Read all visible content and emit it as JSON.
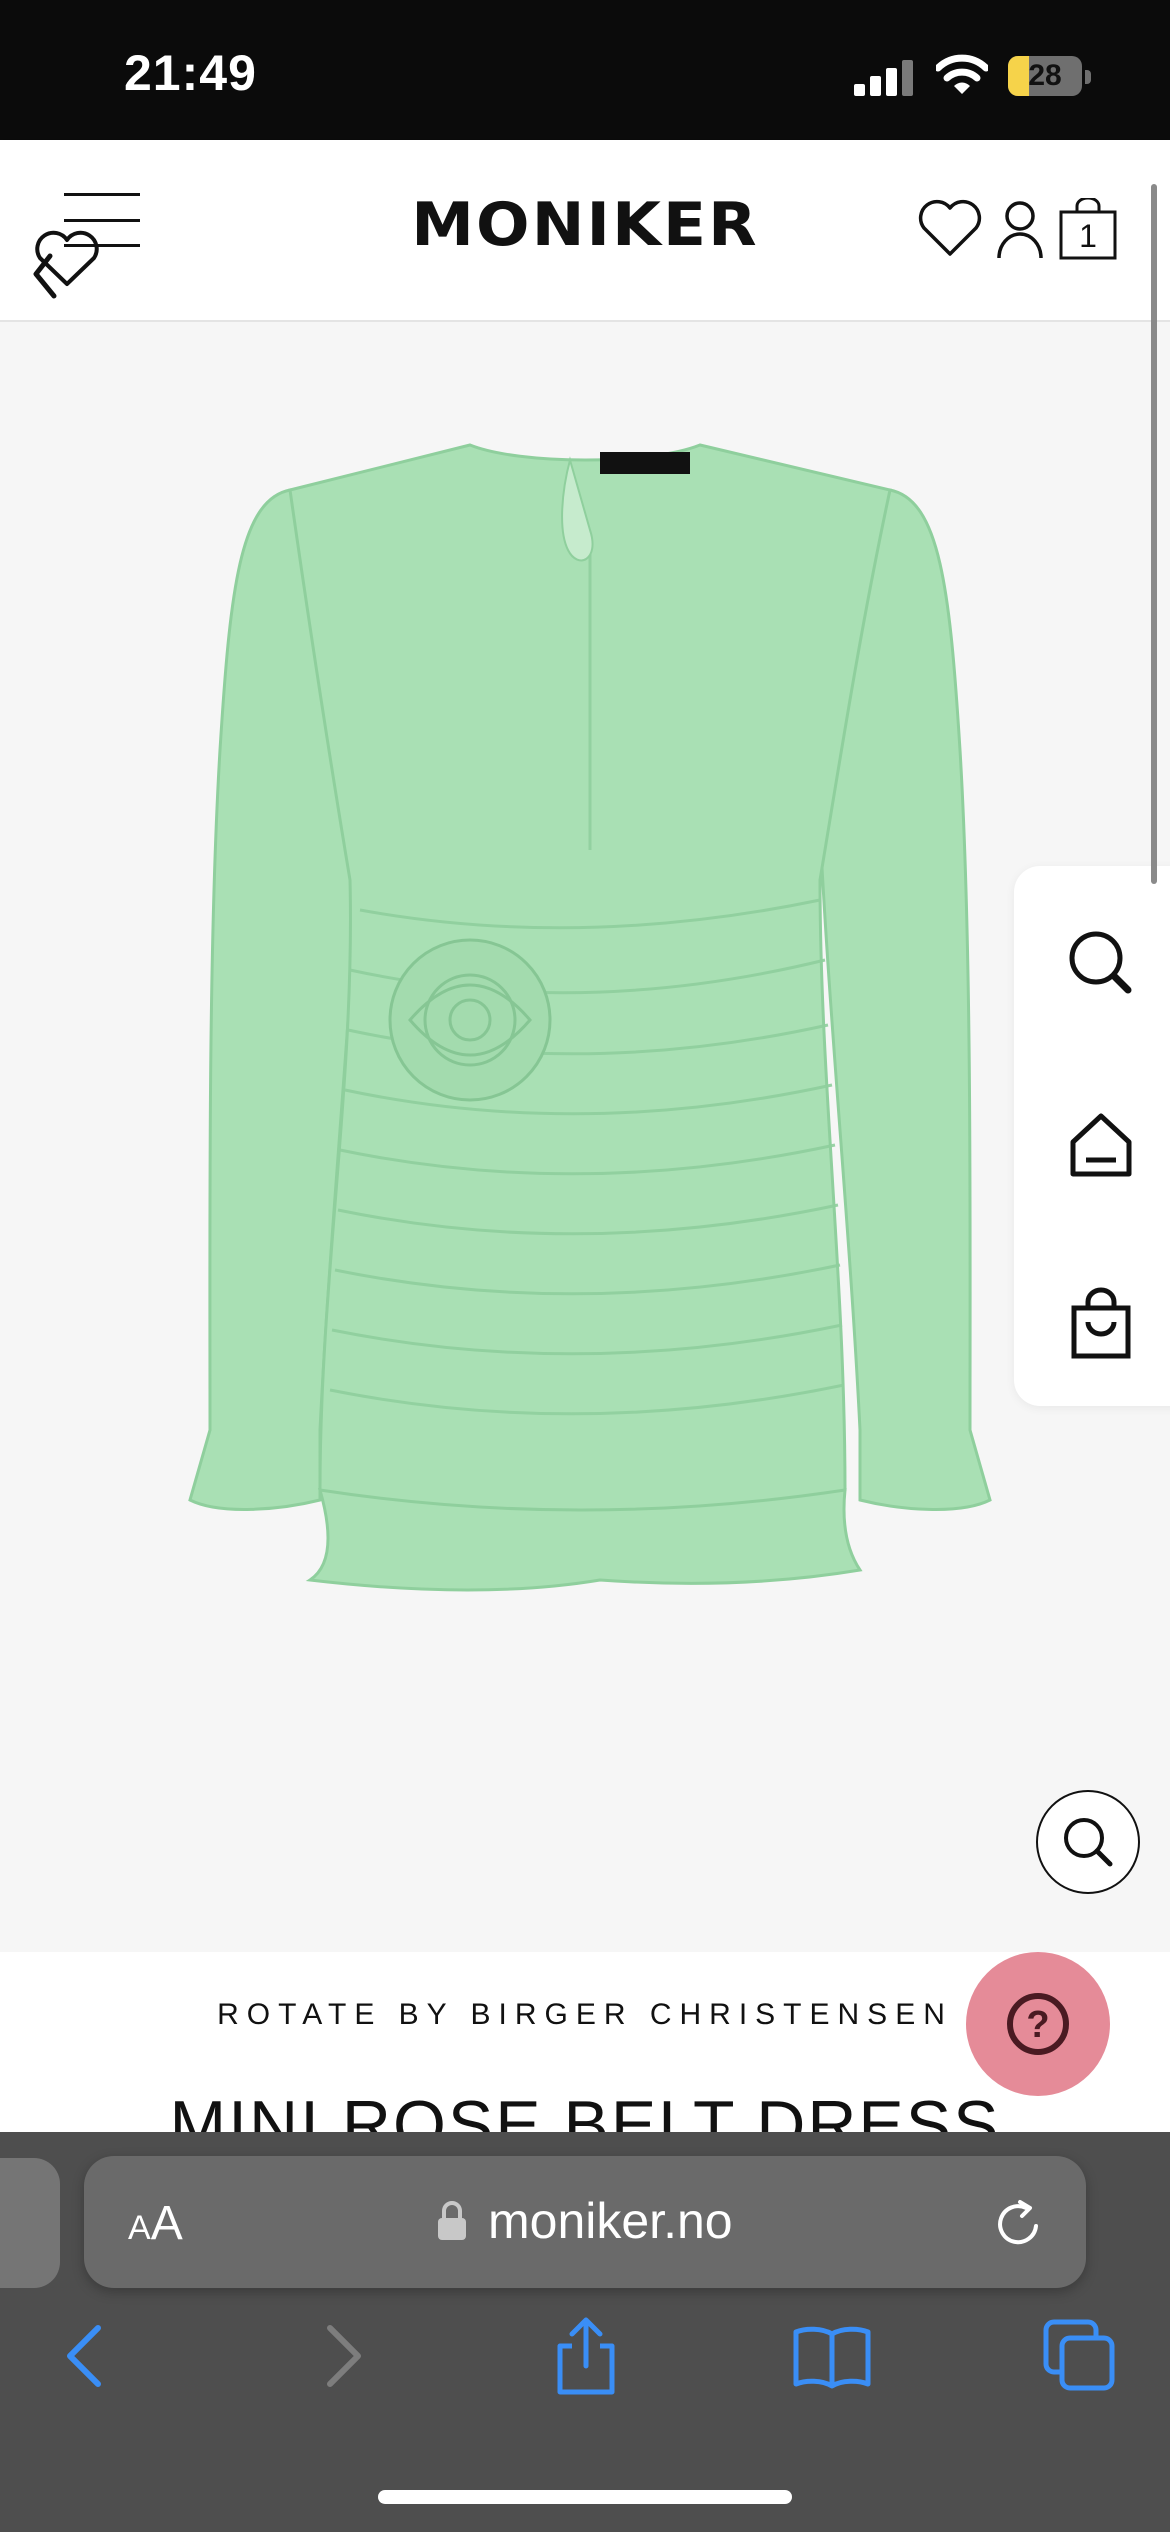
{
  "status_bar": {
    "time": "21:49",
    "battery_percent": 28,
    "battery_text": "28",
    "battery_color": "#f6d34a"
  },
  "header": {
    "logo_text": "MONIKER",
    "cart_count": "1",
    "icons": [
      "menu-icon",
      "wishlist-heart-icon",
      "heart-icon",
      "user-icon",
      "shopping-bag-icon"
    ]
  },
  "product": {
    "image_alt": "Mint green ruched mini dress with rose detail",
    "image_color": "#a9e0b4",
    "brand": "ROTATE BY BIRGER CHRISTENSEN",
    "title": "MINI ROSE BELT DRESS"
  },
  "quick_panel": {
    "icons": [
      "search-icon",
      "home-icon",
      "bag-icon"
    ]
  },
  "help": {
    "label": "?",
    "color": "#e58b98"
  },
  "browser": {
    "aa_label_small": "A",
    "aa_label_large": "A",
    "url": "moniker.no",
    "icons": [
      "back-icon",
      "forward-icon",
      "share-icon",
      "bookmarks-icon",
      "tabs-icon"
    ]
  }
}
